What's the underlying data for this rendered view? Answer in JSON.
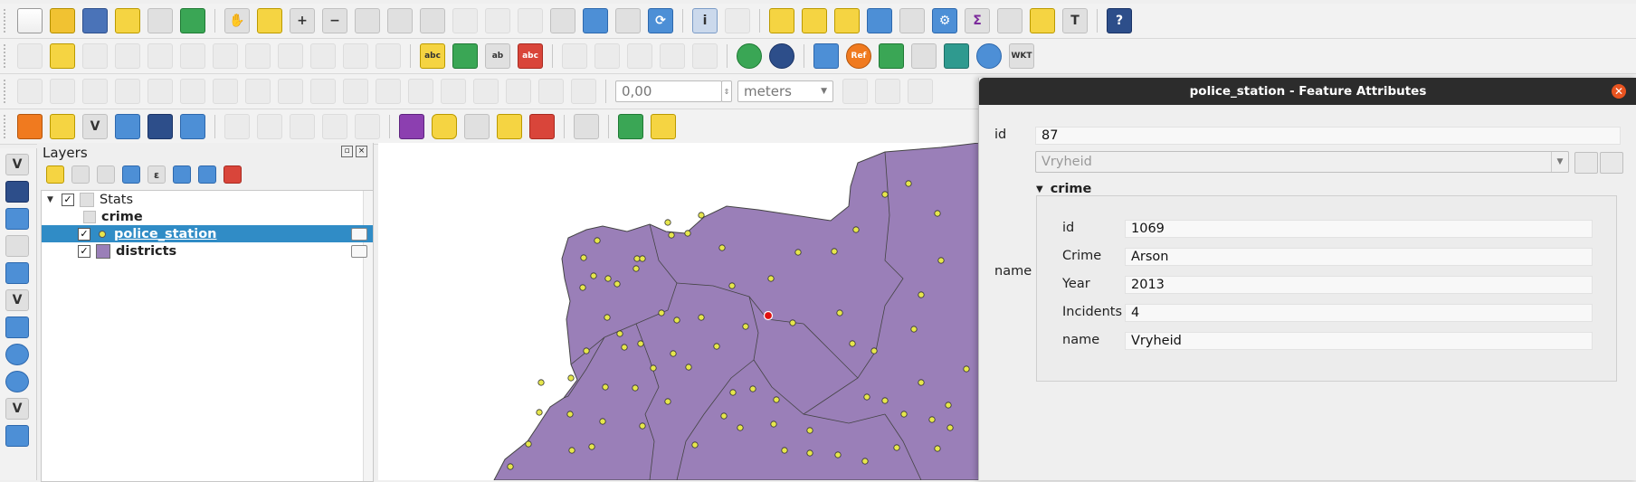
{
  "toolbar1": {
    "icons": [
      "new-project-icon",
      "open-project-icon",
      "save-project-icon",
      "new-print-layout-icon",
      "layout-manager-icon",
      "style-manager-icon",
      "pan-map-icon",
      "pan-to-selection-icon",
      "zoom-in-icon",
      "zoom-out-icon",
      "zoom-full-icon",
      "zoom-to-selection-icon",
      "zoom-to-layer-icon",
      "zoom-native-icon",
      "zoom-last-icon",
      "zoom-next-icon",
      "new-map-view-icon",
      "new-bookmark-icon",
      "show-bookmarks-icon",
      "refresh-icon",
      "identify-features-icon",
      "run-action-icon",
      "select-features-icon",
      "select-by-value-icon",
      "deselect-icon",
      "attribute-table-icon",
      "field-calculator-icon",
      "toolbox-icon",
      "statistics-icon",
      "measure-icon",
      "map-tips-icon",
      "text-annotation-icon",
      "help-icon"
    ]
  },
  "toolbar2": {
    "text_icons": {
      "abc1": "abc",
      "abc2": "abc",
      "abc3": "ab",
      "abc4": "abc",
      "ref": "Ref",
      "wkt": "WKT"
    }
  },
  "toolbar3": {
    "tolerance_value": "0,00",
    "units_value": "meters"
  },
  "layers_panel": {
    "title": "Layers",
    "group_name": "Stats",
    "layers": [
      {
        "name": "crime",
        "checked": false,
        "selected": false
      },
      {
        "name": "police_station",
        "checked": true,
        "selected": true
      },
      {
        "name": "districts",
        "checked": true,
        "selected": false
      }
    ]
  },
  "dialog": {
    "title": "police_station - Feature Attributes",
    "id_label": "id",
    "id_value": "87",
    "name_label": "name",
    "name_combo_value": "Vryheid",
    "relation_header": "crime",
    "related_fields": [
      {
        "label": "id",
        "value": "1069"
      },
      {
        "label": "Crime",
        "value": "Arson"
      },
      {
        "label": "Year",
        "value": "2013"
      },
      {
        "label": "Incidents",
        "value": "4"
      },
      {
        "label": "name",
        "value": "Vryheid"
      }
    ]
  },
  "colors": {
    "district_fill": "#9a7fb8",
    "station_point": "#e6e64c",
    "selected_point": "#e01010",
    "selection_blue": "#308cc6",
    "close_orange": "#e95420"
  }
}
